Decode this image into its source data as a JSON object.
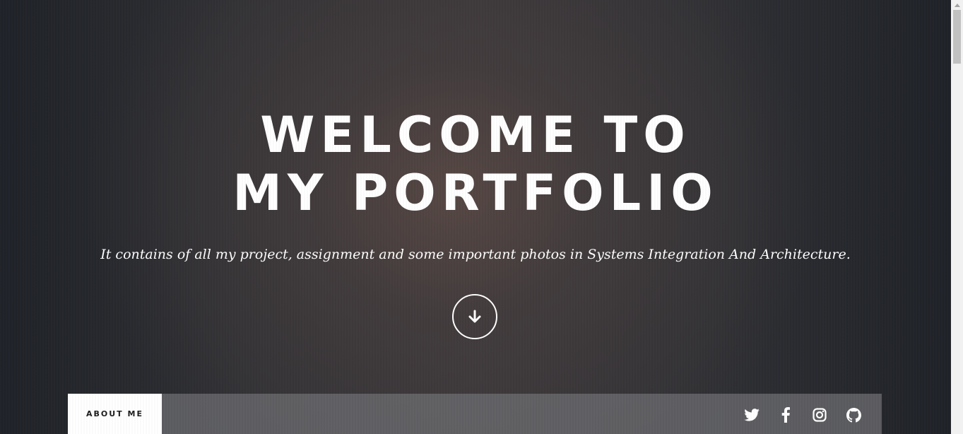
{
  "hero": {
    "title_line1": "WELCOME TO",
    "title_line2": "MY PORTFOLIO",
    "subtitle": "It contains of all my project, assignment and some important photos in Systems Integration And Architecture."
  },
  "scroll_button": {
    "icon": "arrow-down-icon"
  },
  "nav": {
    "active_item": "ABOUT ME",
    "social_icons": [
      "twitter-icon",
      "facebook-icon",
      "instagram-icon",
      "github-icon"
    ]
  },
  "colors": {
    "text": "#ffffff",
    "nav_bar": "#6e6e72",
    "nav_active_bg": "#ffffff",
    "nav_active_text": "#1d1d1d"
  }
}
